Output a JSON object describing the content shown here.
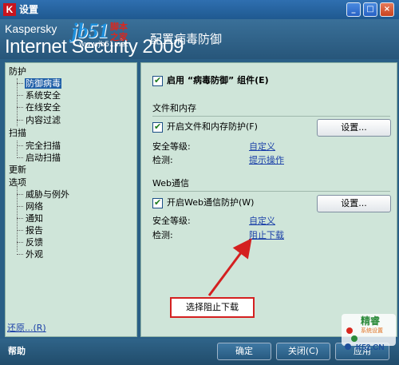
{
  "window": {
    "title": "设置",
    "app_icon": "K"
  },
  "header": {
    "brand_line1": "Kaspersky",
    "brand_line2": "Internet Security 2009",
    "page_title": "配置病毒防御"
  },
  "watermark": {
    "main": "jb51",
    "red1": "脚本",
    "red2": "之家",
    "url": "www.jb51.net",
    "corner_a": "精睿",
    "corner_b": "系统设置",
    "corner_c": "K52.CN"
  },
  "sidebar": {
    "items": [
      {
        "label": "防护"
      },
      {
        "label": "防御病毒"
      },
      {
        "label": "系统安全"
      },
      {
        "label": "在线安全"
      },
      {
        "label": "内容过滤"
      },
      {
        "label": "扫描"
      },
      {
        "label": "完全扫描"
      },
      {
        "label": "启动扫描"
      },
      {
        "label": "更新"
      },
      {
        "label": "选项"
      },
      {
        "label": "威胁与例外"
      },
      {
        "label": "网络"
      },
      {
        "label": "通知"
      },
      {
        "label": "报告"
      },
      {
        "label": "反馈"
      },
      {
        "label": "外观"
      }
    ],
    "restore": "还原...(R)"
  },
  "main": {
    "enable_component": "启用 “病毒防御” 组件(E)",
    "file_section": {
      "title": "文件和内存",
      "enable": "开启文件和内存防护(F)",
      "settings_button": "设置...",
      "security_level_label": "安全等级:",
      "security_level_value": "自定义",
      "detect_label": "检测:",
      "detect_value": "提示操作"
    },
    "web_section": {
      "title": "Web通信",
      "enable": "开启Web通信防护(W)",
      "settings_button": "设置...",
      "security_level_label": "安全等级:",
      "security_level_value": "自定义",
      "detect_label": "检测:",
      "detect_value": "阻止下载"
    }
  },
  "annotation": {
    "callout": "选择阻止下载"
  },
  "footer": {
    "help": "帮助",
    "ok": "确定",
    "close": "关闭(C)",
    "apply": "应用"
  }
}
